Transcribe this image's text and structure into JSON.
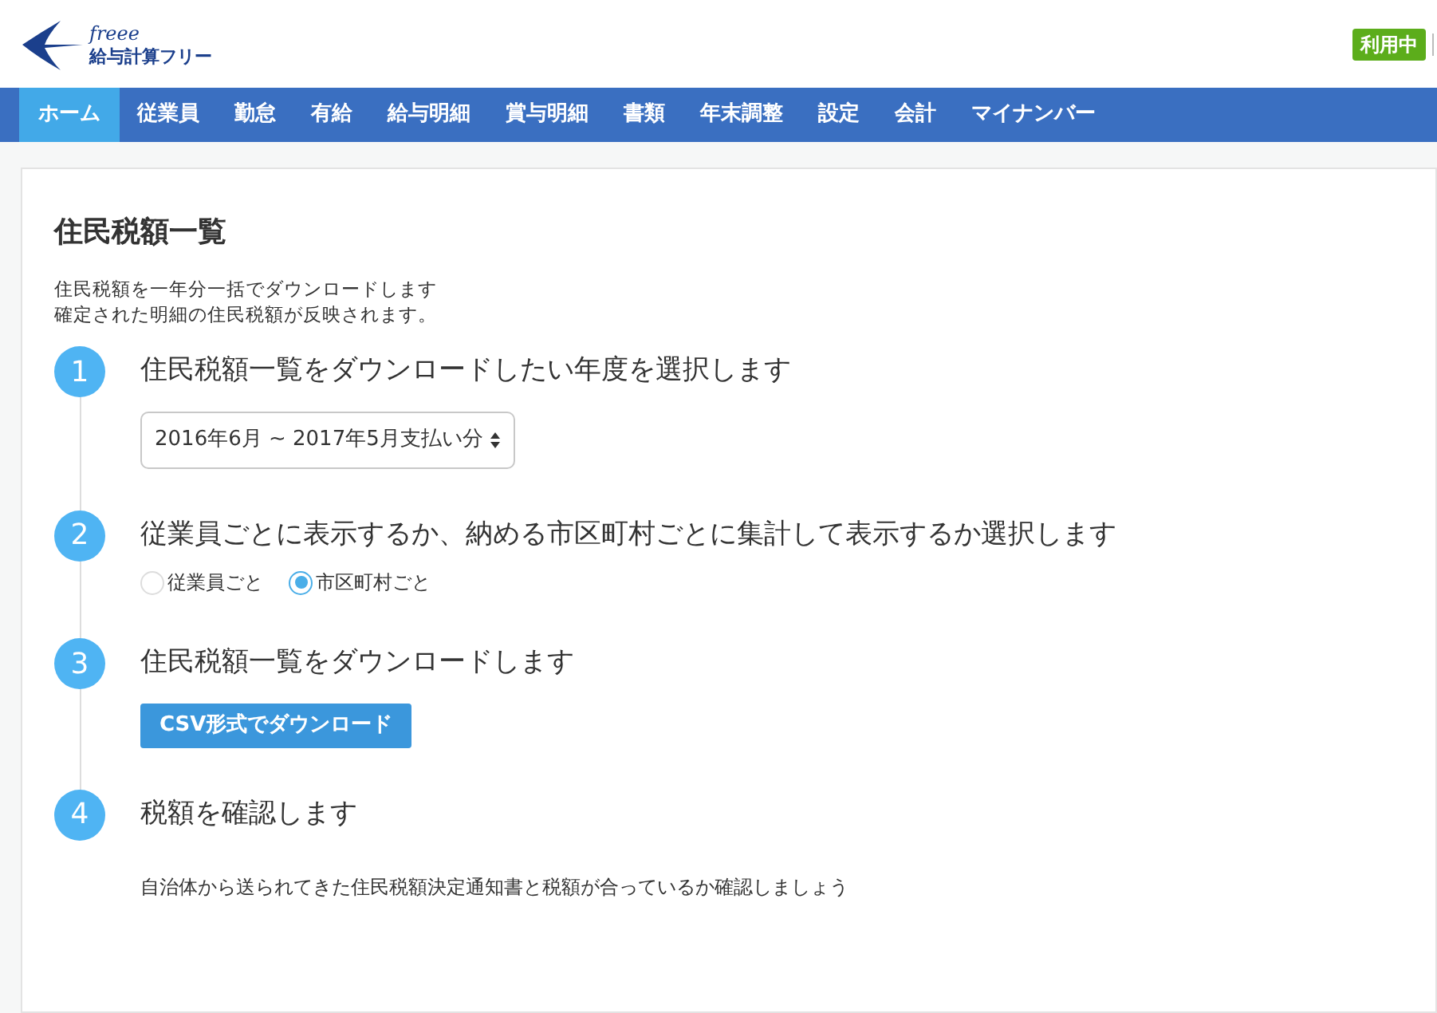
{
  "header": {
    "logo_script": "freee",
    "logo_name": "給与計算フリー",
    "status_badge": "利用中"
  },
  "nav": [
    {
      "label": "ホーム",
      "selected": true
    },
    {
      "label": "従業員",
      "selected": false
    },
    {
      "label": "勤怠",
      "selected": false
    },
    {
      "label": "有給",
      "selected": false
    },
    {
      "label": "給与明細",
      "selected": false
    },
    {
      "label": "賞与明細",
      "selected": false
    },
    {
      "label": "書類",
      "selected": false
    },
    {
      "label": "年末調整",
      "selected": false
    },
    {
      "label": "設定",
      "selected": false
    },
    {
      "label": "会計",
      "selected": false
    },
    {
      "label": "マイナンバー",
      "selected": false
    }
  ],
  "page": {
    "title": "住民税額一覧",
    "description": [
      "住民税額を一年分一括でダウンロードします",
      "確定された明細の住民税額が反映されます。"
    ]
  },
  "steps": [
    {
      "number": "1",
      "heading": "住民税額一覧をダウンロードしたい年度を選択します",
      "kind": "select",
      "value": "2016年6月 ~ 2017年5月支払い分"
    },
    {
      "number": "2",
      "heading": "従業員ごとに表示するか、納める市区町村ごとに集計して表示するか選択します",
      "kind": "radio",
      "options": [
        {
          "label": "従業員ごと",
          "selected": false
        },
        {
          "label": "市区町村ごと",
          "selected": true
        }
      ]
    },
    {
      "number": "3",
      "heading": "住民税額一覧をダウンロードします",
      "kind": "button",
      "button": "CSV形式でダウンロード"
    },
    {
      "number": "4",
      "heading": "税額を確認します",
      "kind": "text",
      "text": "自治体から送られてきた住民税額決定通知書と税額が合っているか確認しましょう"
    }
  ]
}
